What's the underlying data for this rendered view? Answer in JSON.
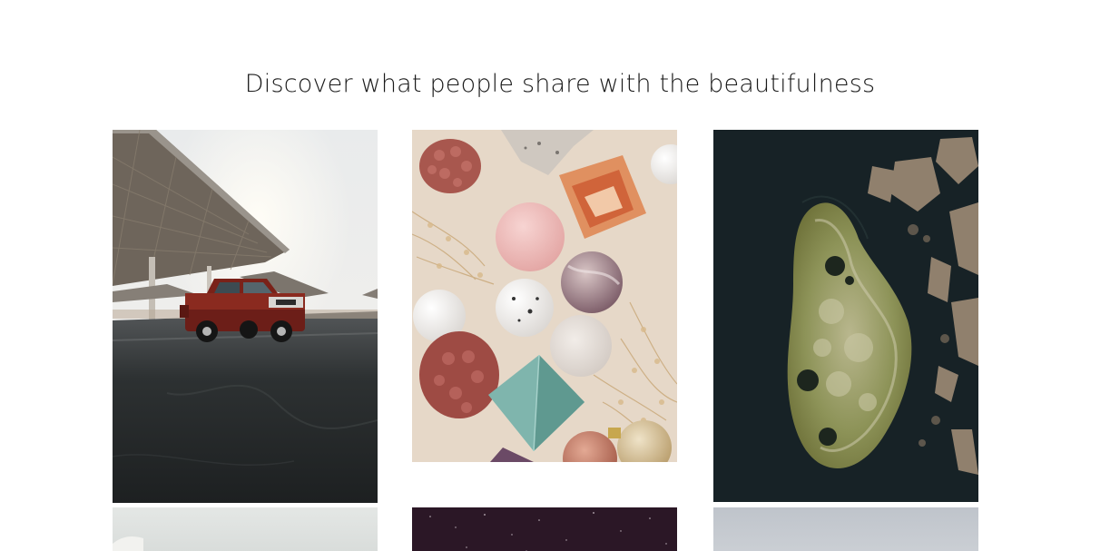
{
  "section": {
    "heading": "Discover what people share with the beautifulness"
  },
  "gallery": {
    "photos": [
      {
        "name": "photo-red-pickup-truck-parking-lot",
        "subject": "red pickup truck parked under solar canopy"
      },
      {
        "name": "photo-crystals-and-pinecones",
        "subject": "crystal spheres, pyramids and glitter pinecones flat lay"
      },
      {
        "name": "photo-aerial-island",
        "subject": "aerial view of a mossy island in dark water"
      },
      {
        "name": "photo-row2-left",
        "subject": "light grey sky"
      },
      {
        "name": "photo-row2-center",
        "subject": "dark purple starry night sky"
      },
      {
        "name": "photo-row2-right",
        "subject": "pale blue-grey sky"
      }
    ]
  },
  "colors": {
    "background": "#ffffff",
    "heading_text": "#1a1a1a"
  }
}
